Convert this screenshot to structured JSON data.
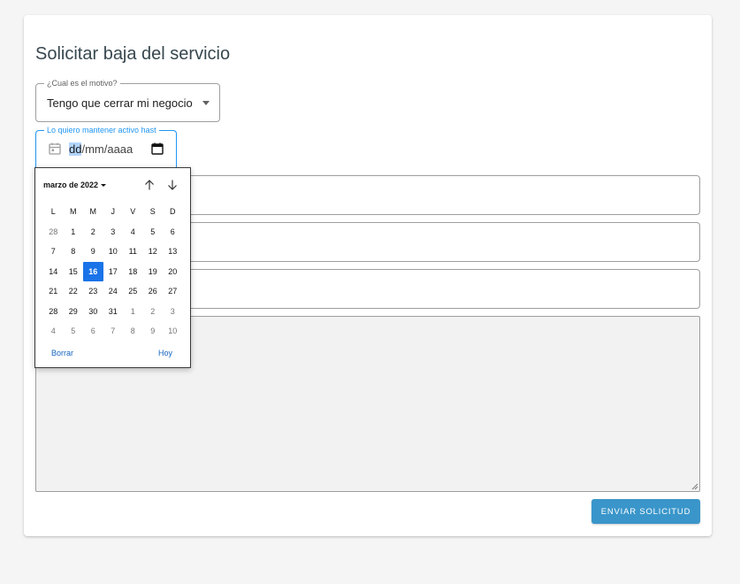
{
  "page": {
    "title": "Solicitar baja del servicio"
  },
  "reason_field": {
    "label": "¿Cual es el motivo?",
    "value": "Tengo que cerrar mi negocio"
  },
  "date_field": {
    "label": "Lo quiero mantener activo hast",
    "placeholder_dd": "dd",
    "placeholder_rest": "/mm/aaaa"
  },
  "datepicker": {
    "month_label": "marzo de 2022",
    "weekdays": [
      "L",
      "M",
      "M",
      "J",
      "V",
      "S",
      "D"
    ],
    "weeks": [
      [
        "28",
        "1",
        "2",
        "3",
        "4",
        "5",
        "6"
      ],
      [
        "7",
        "8",
        "9",
        "10",
        "11",
        "12",
        "13"
      ],
      [
        "14",
        "15",
        "16",
        "17",
        "18",
        "19",
        "20"
      ],
      [
        "21",
        "22",
        "23",
        "24",
        "25",
        "26",
        "27"
      ],
      [
        "28",
        "29",
        "30",
        "31",
        "1",
        "2",
        "3"
      ],
      [
        "4",
        "5",
        "6",
        "7",
        "8",
        "9",
        "10"
      ]
    ],
    "selected_day": "16",
    "clear_label": "Borrar",
    "today_label": "Hoy"
  },
  "submit": {
    "label": "ENVIAR SOLICITUD"
  },
  "colors": {
    "accent": "#3a96ca",
    "selected_day": "#1a73e8",
    "focus": "#2196f3"
  },
  "icons": [
    "calendar-icon",
    "dropdown-arrow-icon",
    "arrow-up-icon",
    "arrow-down-icon"
  ]
}
